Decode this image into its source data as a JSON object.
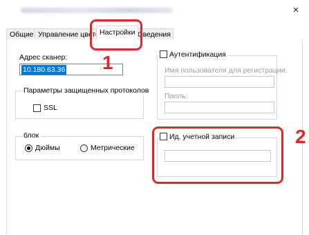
{
  "window": {
    "title": "",
    "close_glyph": "×"
  },
  "tabs": [
    {
      "label": "Общие"
    },
    {
      "label": "Управление цветом"
    },
    {
      "label": "Настройки",
      "active": true
    },
    {
      "label": "Сведения"
    }
  ],
  "scanner": {
    "address_label": "Адрес сканер:",
    "address_value": "10.180.63.36"
  },
  "secure_protocols": {
    "group_title": "Параметры защищенных протоколов",
    "ssl_label": "SSL",
    "ssl_checked": false
  },
  "units": {
    "group_title": "блок",
    "options": [
      {
        "label": "Дюймы",
        "selected": true
      },
      {
        "label": "Метрические",
        "selected": false
      }
    ]
  },
  "authentication": {
    "checkbox_label": "Аутентификация",
    "checked": false,
    "username_label": "Имя пользователя для регистрации:",
    "username_value": "",
    "password_label": "Паоль:",
    "password_value": ""
  },
  "account_id": {
    "checkbox_label": "Ид. учетной записи",
    "checked": false,
    "value": ""
  },
  "annotations": {
    "marker_1": "1",
    "marker_2": "2",
    "highlight_color": "#e3262a"
  },
  "colors": {
    "selection": "#0078d7"
  }
}
